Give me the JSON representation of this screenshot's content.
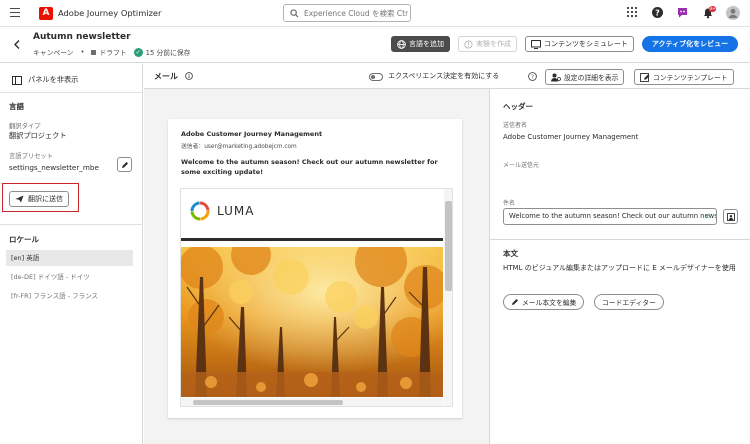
{
  "topbar": {
    "app_title": "Adobe Journey Optimizer",
    "search_placeholder": "Experience Cloud を検索 Ctr...",
    "notification_count": "9+"
  },
  "titlebar": {
    "campaign_title": "Autumn newsletter",
    "campaign_label": "キャンペーン",
    "status": "ドラフト",
    "saved": "15 分前に保存",
    "add_language": "言語を追加",
    "create_experiment": "実験を作成",
    "simulate_content": "コンテンツをシミュレート",
    "review_activate": "アクティブ化をレビュー"
  },
  "leftpanel": {
    "hide_panel": "パネルを非表示",
    "languages_heading": "言語",
    "translation_type_label": "翻訳タイプ",
    "translation_type_value": "翻訳プロジェクト",
    "language_preset_label": "言語プリセット",
    "language_preset_value": "settings_newsletter_mbe",
    "send_translation": "翻訳に送信",
    "locale_heading": "ロケール",
    "locales": [
      "[en] 英語",
      "[de-DE] ドイツ語 - ドイツ",
      "[fr-FR] フランス語 - フランス"
    ]
  },
  "center": {
    "mail_label": "メール",
    "experience_decision": "エクスペリエンス決定を有効にする",
    "show_settings": "設定の詳細を表示",
    "content_template": "コンテンツテンプレート",
    "email": {
      "from_name": "Adobe Customer Journey Management",
      "sender": "送信者：user@marketing.adobejcm.com",
      "subject": "Welcome to the autumn season! Check out our autumn newsletter for some exciting update!",
      "logo_text": "LUMA"
    }
  },
  "rightpanel": {
    "header_heading": "ヘッダー",
    "sender_name_label": "送信者名",
    "sender_name_value": "Adobe Customer Journey Management",
    "sender_email_label": "メール送信元",
    "subject_label": "件名",
    "subject_value": "Welcome to the autumn season! Check out our autumn news...",
    "body_heading": "本文",
    "body_desc": "HTML のビジュアル編集またはアップロードに E メールデザイナーを使用",
    "edit_body": "メール本文を編集",
    "code_editor": "コードエディター"
  },
  "colors": {
    "primary": "#1473e6",
    "adobe_red": "#eb1000",
    "success": "#2d9d78",
    "highlight": "#c9252c"
  }
}
